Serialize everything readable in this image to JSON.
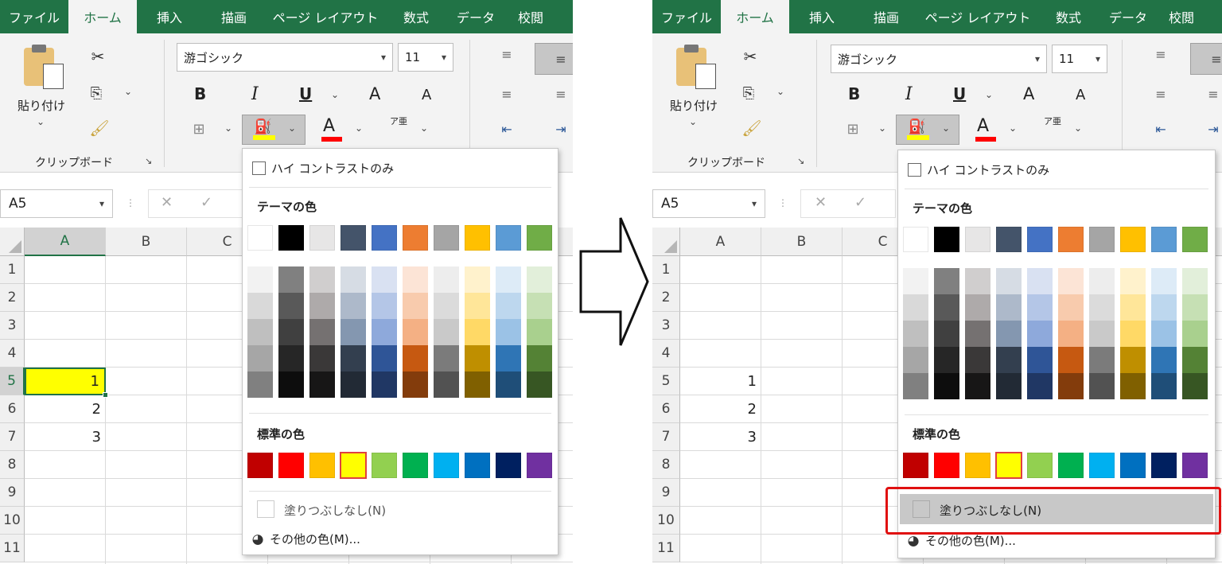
{
  "tabs": [
    "ファイル",
    "ホーム",
    "挿入",
    "描画",
    "ページ レイアウト",
    "数式",
    "データ",
    "校閲"
  ],
  "clipboard": {
    "paste_label": "貼り付け",
    "group_label": "クリップボード"
  },
  "font": {
    "name": "游ゴシック",
    "size": "11",
    "bold": "B",
    "italic": "I",
    "underline": "U",
    "grow": "A",
    "shrink": "A",
    "font_color_glyph": "A",
    "phonetic_glyph": "ア亜"
  },
  "formula_bar": {
    "name_box": "A5",
    "cancel": "✕",
    "enter": "✓"
  },
  "columns": [
    "A",
    "B",
    "C"
  ],
  "rows": [
    "1",
    "2",
    "3",
    "4",
    "5",
    "6",
    "7",
    "8",
    "9",
    "10",
    "11"
  ],
  "cells": {
    "a5": "1",
    "a6": "2",
    "a7": "3"
  },
  "fill_cell_color": "#ffff00",
  "popup": {
    "high_contrast": "ハイ コントラストのみ",
    "theme_title": "テーマの色",
    "standard_title": "標準の色",
    "no_fill": "塗りつぶしなし(N)",
    "more_colors": "その他の色(M)..."
  },
  "theme_colors": [
    "#ffffff",
    "#000000",
    "#e7e6e6",
    "#44546a",
    "#4472c4",
    "#ed7d31",
    "#a5a5a5",
    "#ffc000",
    "#5b9bd5",
    "#70ad47"
  ],
  "theme_shades": [
    [
      "#f2f2f2",
      "#d9d9d9",
      "#bfbfbf",
      "#a6a6a6",
      "#808080"
    ],
    [
      "#808080",
      "#595959",
      "#404040",
      "#262626",
      "#0d0d0d"
    ],
    [
      "#d0cece",
      "#aeaaaa",
      "#757171",
      "#3a3838",
      "#171616"
    ],
    [
      "#d6dce4",
      "#adb9ca",
      "#8497b0",
      "#333f4f",
      "#222a35"
    ],
    [
      "#d9e1f2",
      "#b4c6e7",
      "#8ea9db",
      "#2f5597",
      "#203764"
    ],
    [
      "#fce4d6",
      "#f8cbad",
      "#f4b084",
      "#c65911",
      "#833c0c"
    ],
    [
      "#ededed",
      "#dbdbdb",
      "#c9c9c9",
      "#7b7b7b",
      "#525252"
    ],
    [
      "#fff2cc",
      "#ffe699",
      "#ffd966",
      "#bf8f00",
      "#806000"
    ],
    [
      "#ddebf7",
      "#bdd7ee",
      "#9bc2e6",
      "#2f75b5",
      "#1f4e78"
    ],
    [
      "#e2efda",
      "#c6e0b4",
      "#a9d08e",
      "#548235",
      "#375623"
    ]
  ],
  "standard_colors": [
    "#c00000",
    "#ff0000",
    "#ffc000",
    "#ffff00",
    "#92d050",
    "#00b050",
    "#00b0f0",
    "#0070c0",
    "#002060",
    "#7030a0"
  ],
  "accent_green": "#217346",
  "callout_red": "#e01010"
}
